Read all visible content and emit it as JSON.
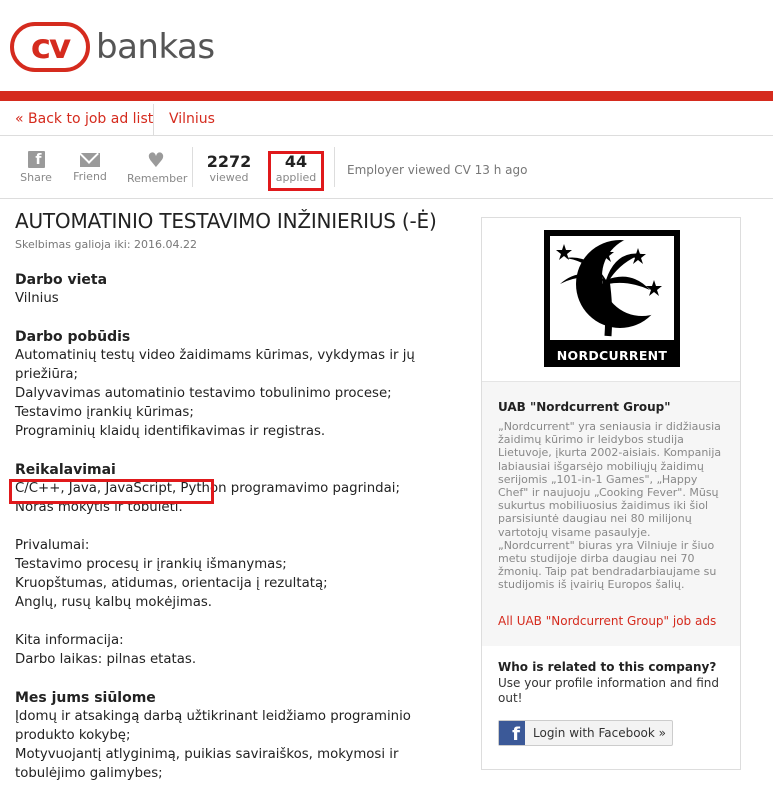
{
  "header": {
    "logo_cv": "cv",
    "logo_bankas": "bankas"
  },
  "nav": {
    "back_label": "« Back to job ad list",
    "city_label": "Vilnius"
  },
  "actions": {
    "share_label": "Share",
    "friend_label": "Friend",
    "remember_label": "Remember"
  },
  "stats": {
    "viewed_count": "2272",
    "viewed_label": "viewed",
    "applied_count": "44",
    "applied_label": "applied",
    "employer_viewed": "Employer viewed CV 13 h ago"
  },
  "job": {
    "title": "AUTOMATINIO TESTAVIMO INŽINIERIUS (-Ė)",
    "valid_until": "Skelbimas galioja iki: 2016.04.22",
    "location_heading": "Darbo vieta",
    "location": "Vilnius",
    "nature_heading": "Darbo pobūdis",
    "nature_lines": [
      "Automatinių testų video žaidimams kūrimas, vykdymas ir jų priežiūra;",
      "Dalyvavimas automatinio testavimo tobulinimo procese;",
      "Testavimo įrankių kūrimas;",
      "Programinių klaidų identifikavimas ir registras."
    ],
    "requirements_heading": "Reikalavimai",
    "requirements_highlight": "C/C++, Java, JavaScript, Python",
    "requirements_rest": " programavimo pagrindai;",
    "requirements_line2": "Noras mokytis ir tobulėti.",
    "advantages_label": "Privalumai:",
    "advantages_lines": [
      "Testavimo procesų ir įrankių išmanymas;",
      "Kruopštumas, atidumas, orientacija į rezultatą;",
      "Anglų, rusų kalbų mokėjimas."
    ],
    "other_label": "Kita informacija:",
    "other_line": "Darbo laikas: pilnas etatas.",
    "offer_heading": "Mes jums siūlome",
    "offer_lines": [
      "Įdomų ir atsakingą darbą užtikrinant leidžiamo programinio produkto kokybę;",
      "Motyvuojantį atlyginimą, puikias saviraiškos, mokymosi ir tobulėjimo galimybes;"
    ]
  },
  "company": {
    "logo_text": "NORDCURRENT",
    "name": "UAB \"Nordcurrent Group\"",
    "description": "„Nordcurrent\" yra seniausia ir didžiausia žaidimų kūrimo ir leidybos studija Lietuvoje, įkurta 2002-aisiais. Kompanija labiausiai išgarsėjo mobiliųjų žaidimų serijomis „101-in-1 Games\", „Happy Chef\" ir naujuoju „Cooking Fever\". Mūsų sukurtus mobiliuosius žaidimus iki šiol parsisiuntė daugiau nei 80 milijonų vartotojų visame pasaulyje. „Nordcurrent\" biuras yra Vilniuje ir šiuo metu studijoje dirba daugiau nei 70 žmonių. Taip pat bendradarbiaujame su studijomis iš įvairių Europos šalių.",
    "all_ads_link": "All UAB \"Nordcurrent Group\" job ads",
    "related_heading": "Who is related to this company?",
    "related_text": "Use your profile information and find out!",
    "fb_button": "Login with Facebook »"
  },
  "colors": {
    "brand_red": "#d52b1e",
    "highlight_red": "#e0191b",
    "facebook_blue": "#3b5998"
  }
}
